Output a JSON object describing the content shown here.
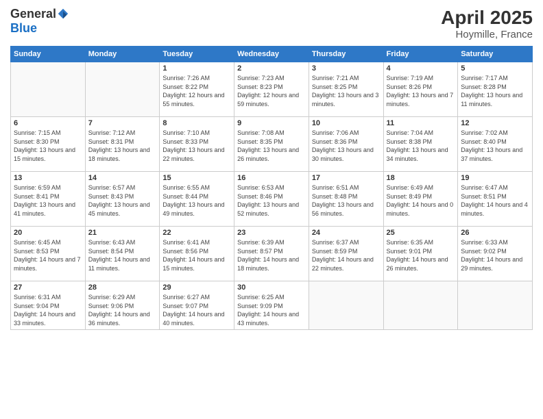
{
  "logo": {
    "general": "General",
    "blue": "Blue"
  },
  "header": {
    "month": "April 2025",
    "location": "Hoymille, France"
  },
  "weekdays": [
    "Sunday",
    "Monday",
    "Tuesday",
    "Wednesday",
    "Thursday",
    "Friday",
    "Saturday"
  ],
  "days": [
    {
      "day": "",
      "info": ""
    },
    {
      "day": "",
      "info": ""
    },
    {
      "day": "1",
      "info": "Sunrise: 7:26 AM\nSunset: 8:22 PM\nDaylight: 12 hours and 55 minutes."
    },
    {
      "day": "2",
      "info": "Sunrise: 7:23 AM\nSunset: 8:23 PM\nDaylight: 12 hours and 59 minutes."
    },
    {
      "day": "3",
      "info": "Sunrise: 7:21 AM\nSunset: 8:25 PM\nDaylight: 13 hours and 3 minutes."
    },
    {
      "day": "4",
      "info": "Sunrise: 7:19 AM\nSunset: 8:26 PM\nDaylight: 13 hours and 7 minutes."
    },
    {
      "day": "5",
      "info": "Sunrise: 7:17 AM\nSunset: 8:28 PM\nDaylight: 13 hours and 11 minutes."
    },
    {
      "day": "6",
      "info": "Sunrise: 7:15 AM\nSunset: 8:30 PM\nDaylight: 13 hours and 15 minutes."
    },
    {
      "day": "7",
      "info": "Sunrise: 7:12 AM\nSunset: 8:31 PM\nDaylight: 13 hours and 18 minutes."
    },
    {
      "day": "8",
      "info": "Sunrise: 7:10 AM\nSunset: 8:33 PM\nDaylight: 13 hours and 22 minutes."
    },
    {
      "day": "9",
      "info": "Sunrise: 7:08 AM\nSunset: 8:35 PM\nDaylight: 13 hours and 26 minutes."
    },
    {
      "day": "10",
      "info": "Sunrise: 7:06 AM\nSunset: 8:36 PM\nDaylight: 13 hours and 30 minutes."
    },
    {
      "day": "11",
      "info": "Sunrise: 7:04 AM\nSunset: 8:38 PM\nDaylight: 13 hours and 34 minutes."
    },
    {
      "day": "12",
      "info": "Sunrise: 7:02 AM\nSunset: 8:40 PM\nDaylight: 13 hours and 37 minutes."
    },
    {
      "day": "13",
      "info": "Sunrise: 6:59 AM\nSunset: 8:41 PM\nDaylight: 13 hours and 41 minutes."
    },
    {
      "day": "14",
      "info": "Sunrise: 6:57 AM\nSunset: 8:43 PM\nDaylight: 13 hours and 45 minutes."
    },
    {
      "day": "15",
      "info": "Sunrise: 6:55 AM\nSunset: 8:44 PM\nDaylight: 13 hours and 49 minutes."
    },
    {
      "day": "16",
      "info": "Sunrise: 6:53 AM\nSunset: 8:46 PM\nDaylight: 13 hours and 52 minutes."
    },
    {
      "day": "17",
      "info": "Sunrise: 6:51 AM\nSunset: 8:48 PM\nDaylight: 13 hours and 56 minutes."
    },
    {
      "day": "18",
      "info": "Sunrise: 6:49 AM\nSunset: 8:49 PM\nDaylight: 14 hours and 0 minutes."
    },
    {
      "day": "19",
      "info": "Sunrise: 6:47 AM\nSunset: 8:51 PM\nDaylight: 14 hours and 4 minutes."
    },
    {
      "day": "20",
      "info": "Sunrise: 6:45 AM\nSunset: 8:53 PM\nDaylight: 14 hours and 7 minutes."
    },
    {
      "day": "21",
      "info": "Sunrise: 6:43 AM\nSunset: 8:54 PM\nDaylight: 14 hours and 11 minutes."
    },
    {
      "day": "22",
      "info": "Sunrise: 6:41 AM\nSunset: 8:56 PM\nDaylight: 14 hours and 15 minutes."
    },
    {
      "day": "23",
      "info": "Sunrise: 6:39 AM\nSunset: 8:57 PM\nDaylight: 14 hours and 18 minutes."
    },
    {
      "day": "24",
      "info": "Sunrise: 6:37 AM\nSunset: 8:59 PM\nDaylight: 14 hours and 22 minutes."
    },
    {
      "day": "25",
      "info": "Sunrise: 6:35 AM\nSunset: 9:01 PM\nDaylight: 14 hours and 26 minutes."
    },
    {
      "day": "26",
      "info": "Sunrise: 6:33 AM\nSunset: 9:02 PM\nDaylight: 14 hours and 29 minutes."
    },
    {
      "day": "27",
      "info": "Sunrise: 6:31 AM\nSunset: 9:04 PM\nDaylight: 14 hours and 33 minutes."
    },
    {
      "day": "28",
      "info": "Sunrise: 6:29 AM\nSunset: 9:06 PM\nDaylight: 14 hours and 36 minutes."
    },
    {
      "day": "29",
      "info": "Sunrise: 6:27 AM\nSunset: 9:07 PM\nDaylight: 14 hours and 40 minutes."
    },
    {
      "day": "30",
      "info": "Sunrise: 6:25 AM\nSunset: 9:09 PM\nDaylight: 14 hours and 43 minutes."
    },
    {
      "day": "",
      "info": ""
    },
    {
      "day": "",
      "info": ""
    },
    {
      "day": "",
      "info": ""
    }
  ]
}
